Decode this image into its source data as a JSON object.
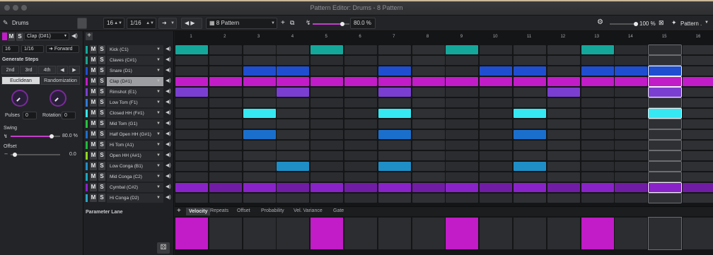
{
  "window": {
    "title": "Pattern Editor: Drums - 8 Pattern"
  },
  "toolbar": {
    "steps": "16",
    "resolution": "1/16",
    "direction_icon": "arrow-right-icon",
    "pattern_name": "8 Pattern",
    "swing_percent": "80.0 %",
    "zoom_percent": "100 %",
    "pattern_menu": "Pattern ."
  },
  "instrument": {
    "name": "Drums"
  },
  "left": {
    "selected_track": "Clap (D#1)",
    "steps": "16",
    "resolution": "1/16",
    "direction": "Forward",
    "generate_steps_label": "Generate Steps",
    "step_buttons": [
      "2nd",
      "3rd",
      "4th"
    ],
    "modes": [
      "Euclidean",
      "Randomization"
    ],
    "pulses_label": "Pulses",
    "pulses_value": "0",
    "rotation_label": "Rotation",
    "rotation_value": "0",
    "swing_label": "Swing",
    "swing_value": "80.0 %",
    "swing_level": 0.8,
    "offset_label": "Offset",
    "offset_value": "0.0",
    "parameter_lane_label": "Parameter Lane"
  },
  "tracks": [
    {
      "name": "Kick (C1)",
      "color": "#14a89b"
    },
    {
      "name": "Claves (C#1)",
      "color": "#1aa38f"
    },
    {
      "name": "Snare (D1)",
      "color": "#1f4fd0"
    },
    {
      "name": "Clap (D#1)",
      "color": "#c21bc8",
      "selected": true
    },
    {
      "name": "Rimshot (E1)",
      "color": "#7a3fd0"
    },
    {
      "name": "Low Tom (F1)",
      "color": "#2e7bd6"
    },
    {
      "name": "Closed HH (F#1)",
      "color": "#35e8f2"
    },
    {
      "name": "Mid Tom (G1)",
      "color": "#26c23e"
    },
    {
      "name": "Half Open HH (G#1)",
      "color": "#1b6fcc"
    },
    {
      "name": "Hi Tom (A1)",
      "color": "#1fb83a"
    },
    {
      "name": "Open HH (A#1)",
      "color": "#8fd61f"
    },
    {
      "name": "Low Conga (B1)",
      "color": "#1f8ec7"
    },
    {
      "name": "Mid Conga (C2)",
      "color": "#1aa7c0"
    },
    {
      "name": "Cymbal (C#2)",
      "color": "#8a22c9"
    },
    {
      "name": "Hi Conga (D2)",
      "color": "#2aa3c5"
    }
  ],
  "track_buttons": {
    "mute": "M",
    "solo": "S"
  },
  "columns": [
    "1",
    "2",
    "3",
    "4",
    "5",
    "6",
    "7",
    "8",
    "9",
    "10",
    "11",
    "12",
    "13",
    "14",
    "15",
    "16"
  ],
  "grid": {
    "on_steps": [
      [
        1,
        5,
        9,
        13
      ],
      [],
      [
        3,
        4,
        7,
        10,
        11,
        13,
        14,
        15
      ],
      [
        1,
        2,
        3,
        4,
        5,
        6,
        7,
        8,
        9,
        10,
        11,
        12,
        13,
        14,
        15,
        16
      ],
      [
        1,
        4,
        7,
        12,
        15
      ],
      [],
      [
        3,
        7,
        11,
        15
      ],
      [],
      [
        3,
        7,
        11
      ],
      [],
      [],
      [
        4,
        7,
        11
      ],
      [],
      [
        1,
        2,
        3,
        4,
        5,
        6,
        7,
        8,
        9,
        10,
        11,
        12,
        13,
        14,
        15,
        16
      ],
      []
    ],
    "playhead_column": 15
  },
  "lane_tabs": [
    "Velocity",
    "Repeats",
    "Offset",
    "Probability",
    "Vel. Variance",
    "Gate"
  ],
  "velocity_on_steps": [
    1,
    5,
    9,
    13
  ]
}
